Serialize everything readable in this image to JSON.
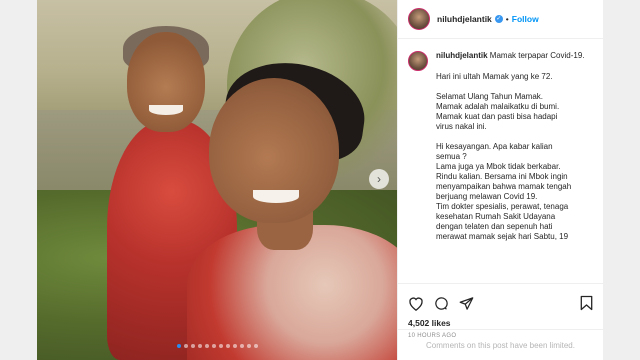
{
  "post": {
    "username": "niluhdjelantik",
    "follow_label": "Follow",
    "dot": "•",
    "verified_mark": "✓",
    "caption_paragraphs": [
      "Hari ini ultah Mamak yang ke 72.",
      "Selamat Ulang Tahun Mamak.\nMamak adalah malaikatku di bumi.\nMamak kuat dan pasti bisa hadapi\nvirus nakal ini.",
      "Hi kesayangan. Apa kabar kalian\nsemua ?\nLama juga ya Mbok tidak berkabar.\nRindu kalian. Bersama ini Mbok ingin\nmenyampaikan bahwa mamak tengah\nberjuang melawan Covid 19.\nTim dokter spesialis, perawat, tenaga\nkesehatan Rumah Sakit Udayana\ndengan telaten dan sepenuh hati\nmerawat mamak sejak hari Sabtu, 19"
    ],
    "caption_first": "Mamak terpapar Covid-19.",
    "likes": "4,502 likes",
    "timestamp": "10 HOURS AGO",
    "comments_note": "Comments on this post have been limited.",
    "carousel": {
      "slide_count": 12,
      "active_index": 0
    }
  },
  "icons": {
    "next": "›",
    "like": "heart-icon",
    "comment": "comment-icon",
    "share": "share-icon",
    "save": "bookmark-icon"
  },
  "colors": {
    "follow": "#0095f6",
    "verified": "#3897f0",
    "active_dot": "#2a8cf0"
  }
}
